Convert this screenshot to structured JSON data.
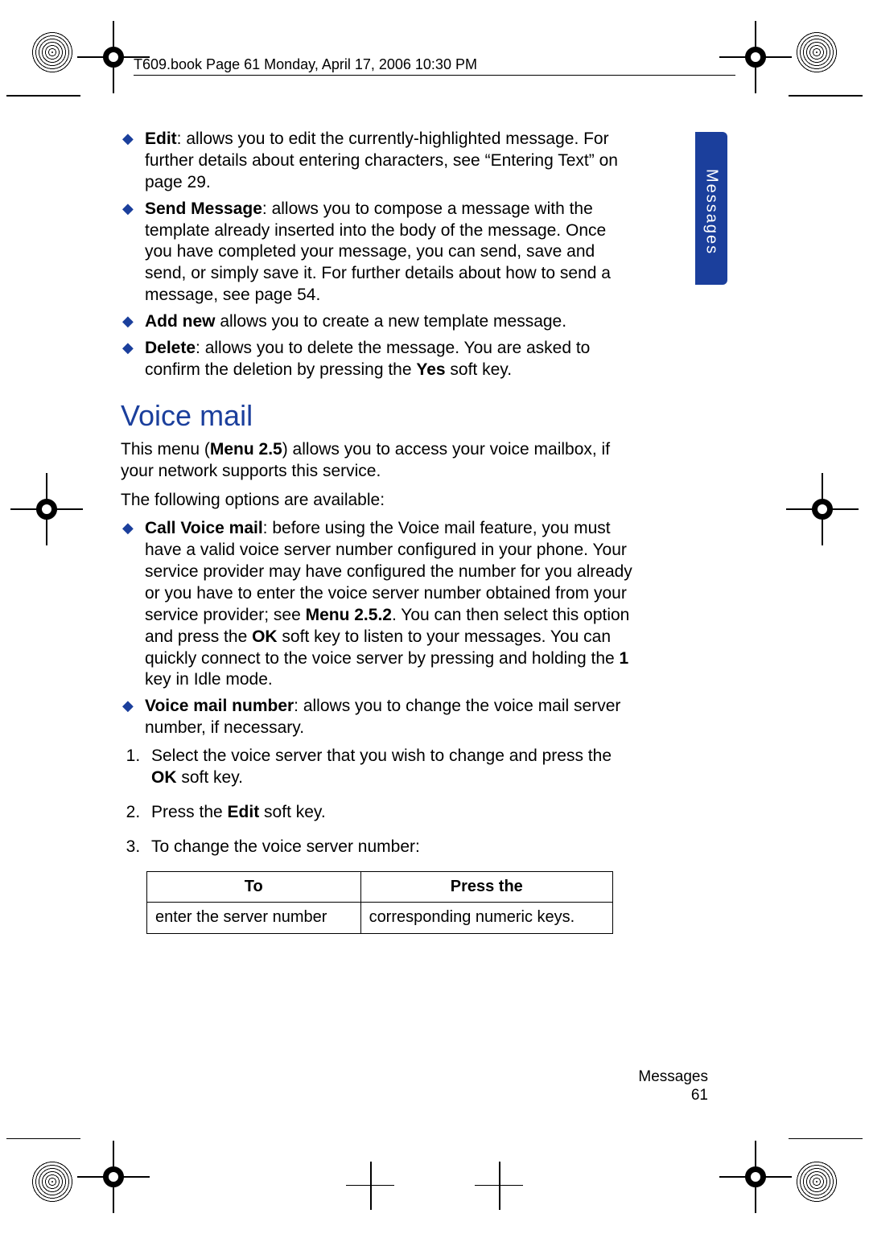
{
  "header": "T609.book  Page 61  Monday, April 17, 2006  10:30 PM",
  "tab_label": "Messages",
  "top_bullets": [
    {
      "label": "Edit",
      "text": ": allows you to edit the currently-highlighted message. For further details about entering characters, see “Entering Text” on page 29."
    },
    {
      "label": "Send Message",
      "text": ": allows you to compose a message with the template already inserted into the body of the message. Once you have completed your message, you can send, save and send, or simply save it. For further details about how to send a message, see page 54."
    },
    {
      "label": "Add new",
      "text": " allows you to create a new template message."
    },
    {
      "label": "Delete",
      "text_pre": ": allows you to delete the message. You are asked to confirm the deletion by pressing the ",
      "bold_in": "Yes",
      "text_post": " soft key."
    }
  ],
  "section_title": "Voice mail",
  "section_intro_pre": "This menu (",
  "section_intro_bold": "Menu 2.5",
  "section_intro_post": ") allows you to access your voice mailbox, if your network supports this service.",
  "options_line": "The following options are available:",
  "voice_bullets": [
    {
      "label": "Call Voice mail",
      "text_1": ": before using the Voice mail feature, you must have a valid voice server number configured in your phone. Your service provider may have configured the number for you already or you have to enter the voice server number obtained from your service provider; see ",
      "bold_1": "Menu 2.5.2",
      "text_2": ". You can then select this option and press the ",
      "bold_2": "OK",
      "text_3": " soft key to listen to your messages. You can quickly connect to the voice server by pressing and holding the ",
      "bold_3": "1",
      "text_4": " key in Idle mode."
    },
    {
      "label": "Voice mail number",
      "text_1": ": allows you to change the voice mail server number, if necessary."
    }
  ],
  "steps": [
    {
      "pre": "Select the voice server that you wish to change and press the ",
      "bold": "OK",
      "post": " soft key."
    },
    {
      "pre": "Press the ",
      "bold": "Edit",
      "post": " soft key."
    },
    {
      "pre": "To change the voice server number:",
      "bold": "",
      "post": ""
    }
  ],
  "table": {
    "head": [
      "To",
      "Press the"
    ],
    "rows": [
      [
        "enter the server number",
        "corresponding numeric keys."
      ]
    ]
  },
  "footer_label": "Messages",
  "page_number": "61"
}
